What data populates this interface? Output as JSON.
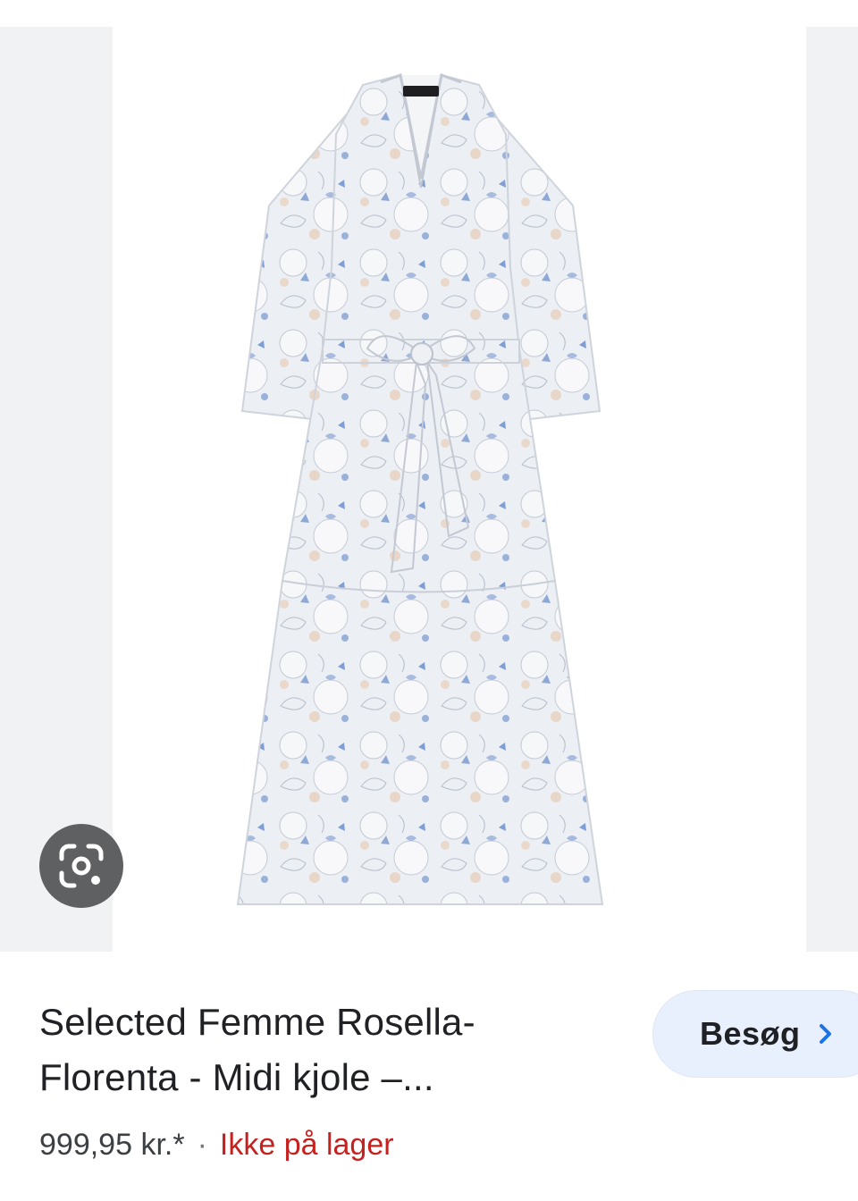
{
  "product": {
    "title_line1": "Selected Femme Rosella-",
    "title_line2": "Florenta - Midi kjole –...",
    "price": "999,95 kr.*",
    "separator": "·",
    "stock_status": "Ikke på lager"
  },
  "actions": {
    "visit_label": "Besøg"
  },
  "icons": {
    "lens": "google-lens-icon",
    "visit_chevron": "chevron-right-icon"
  },
  "colors": {
    "stock_status": "#c5221f",
    "visit_button_bg": "#e8f0fe",
    "chevron": "#1a73e8",
    "lens_button_bg": "#5f6062"
  }
}
